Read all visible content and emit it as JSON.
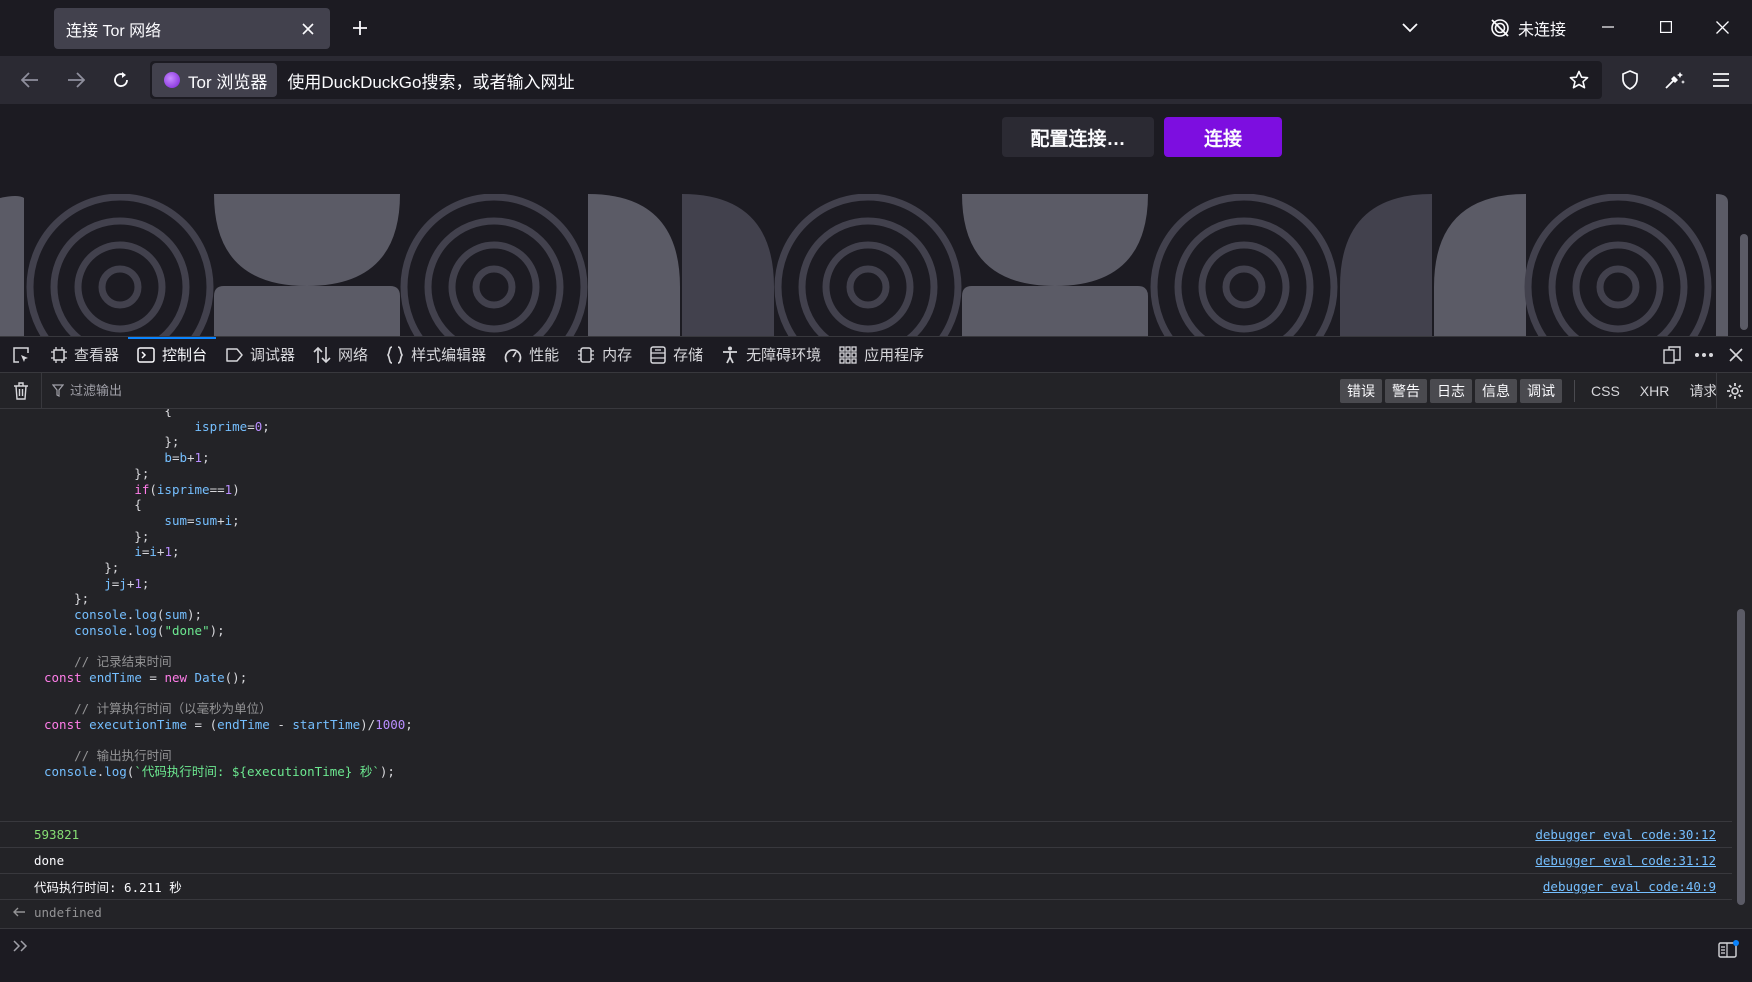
{
  "browser": {
    "tab_title": "连接 Tor 网络",
    "connection_status": "未连接",
    "identity_label": "Tor 浏览器",
    "url_placeholder": "使用DuckDuckGo搜索，或者输入网址"
  },
  "page": {
    "configure_button": "配置连接…",
    "connect_button": "连接"
  },
  "devtools": {
    "tabs": [
      {
        "label": "查看器",
        "icon": "inspector-icon"
      },
      {
        "label": "控制台",
        "icon": "console-icon",
        "selected": true
      },
      {
        "label": "调试器",
        "icon": "debugger-icon"
      },
      {
        "label": "网络",
        "icon": "network-icon"
      },
      {
        "label": "样式编辑器",
        "icon": "style-editor-icon"
      },
      {
        "label": "性能",
        "icon": "performance-icon"
      },
      {
        "label": "内存",
        "icon": "memory-icon"
      },
      {
        "label": "存储",
        "icon": "storage-icon"
      },
      {
        "label": "无障碍环境",
        "icon": "accessibility-icon"
      },
      {
        "label": "应用程序",
        "icon": "application-icon"
      }
    ],
    "filter_placeholder": "过滤输出",
    "levels": [
      "错误",
      "警告",
      "日志",
      "信息",
      "调试"
    ],
    "net_filters": [
      "CSS",
      "XHR",
      "请求"
    ],
    "code_lines": [
      "                {",
      "                    isprime=0;",
      "                };",
      "                b=b+1;",
      "            };",
      "            if(isprime==1)",
      "            {",
      "                sum=sum+i;",
      "            };",
      "            i=i+1;",
      "        };",
      "        j=j+1;",
      "    };",
      "    console.log(sum);",
      "    console.log(\"done\");",
      "",
      "    // 记录结束时间",
      "const endTime = new Date();",
      "",
      "    // 计算执行时间（以毫秒为单位）",
      "const executionTime = (endTime - startTime)/1000;",
      "",
      "    // 输出执行时间",
      "console.log(`代码执行时间: ${executionTime} 秒`);"
    ],
    "messages": [
      {
        "text": "593821",
        "location": "debugger eval code:30:12"
      },
      {
        "text": "done",
        "location": "debugger eval code:31:12"
      },
      {
        "text": "代码执行时间: 6.211 秒",
        "location": "debugger eval code:40:9"
      }
    ],
    "result": "undefined"
  }
}
